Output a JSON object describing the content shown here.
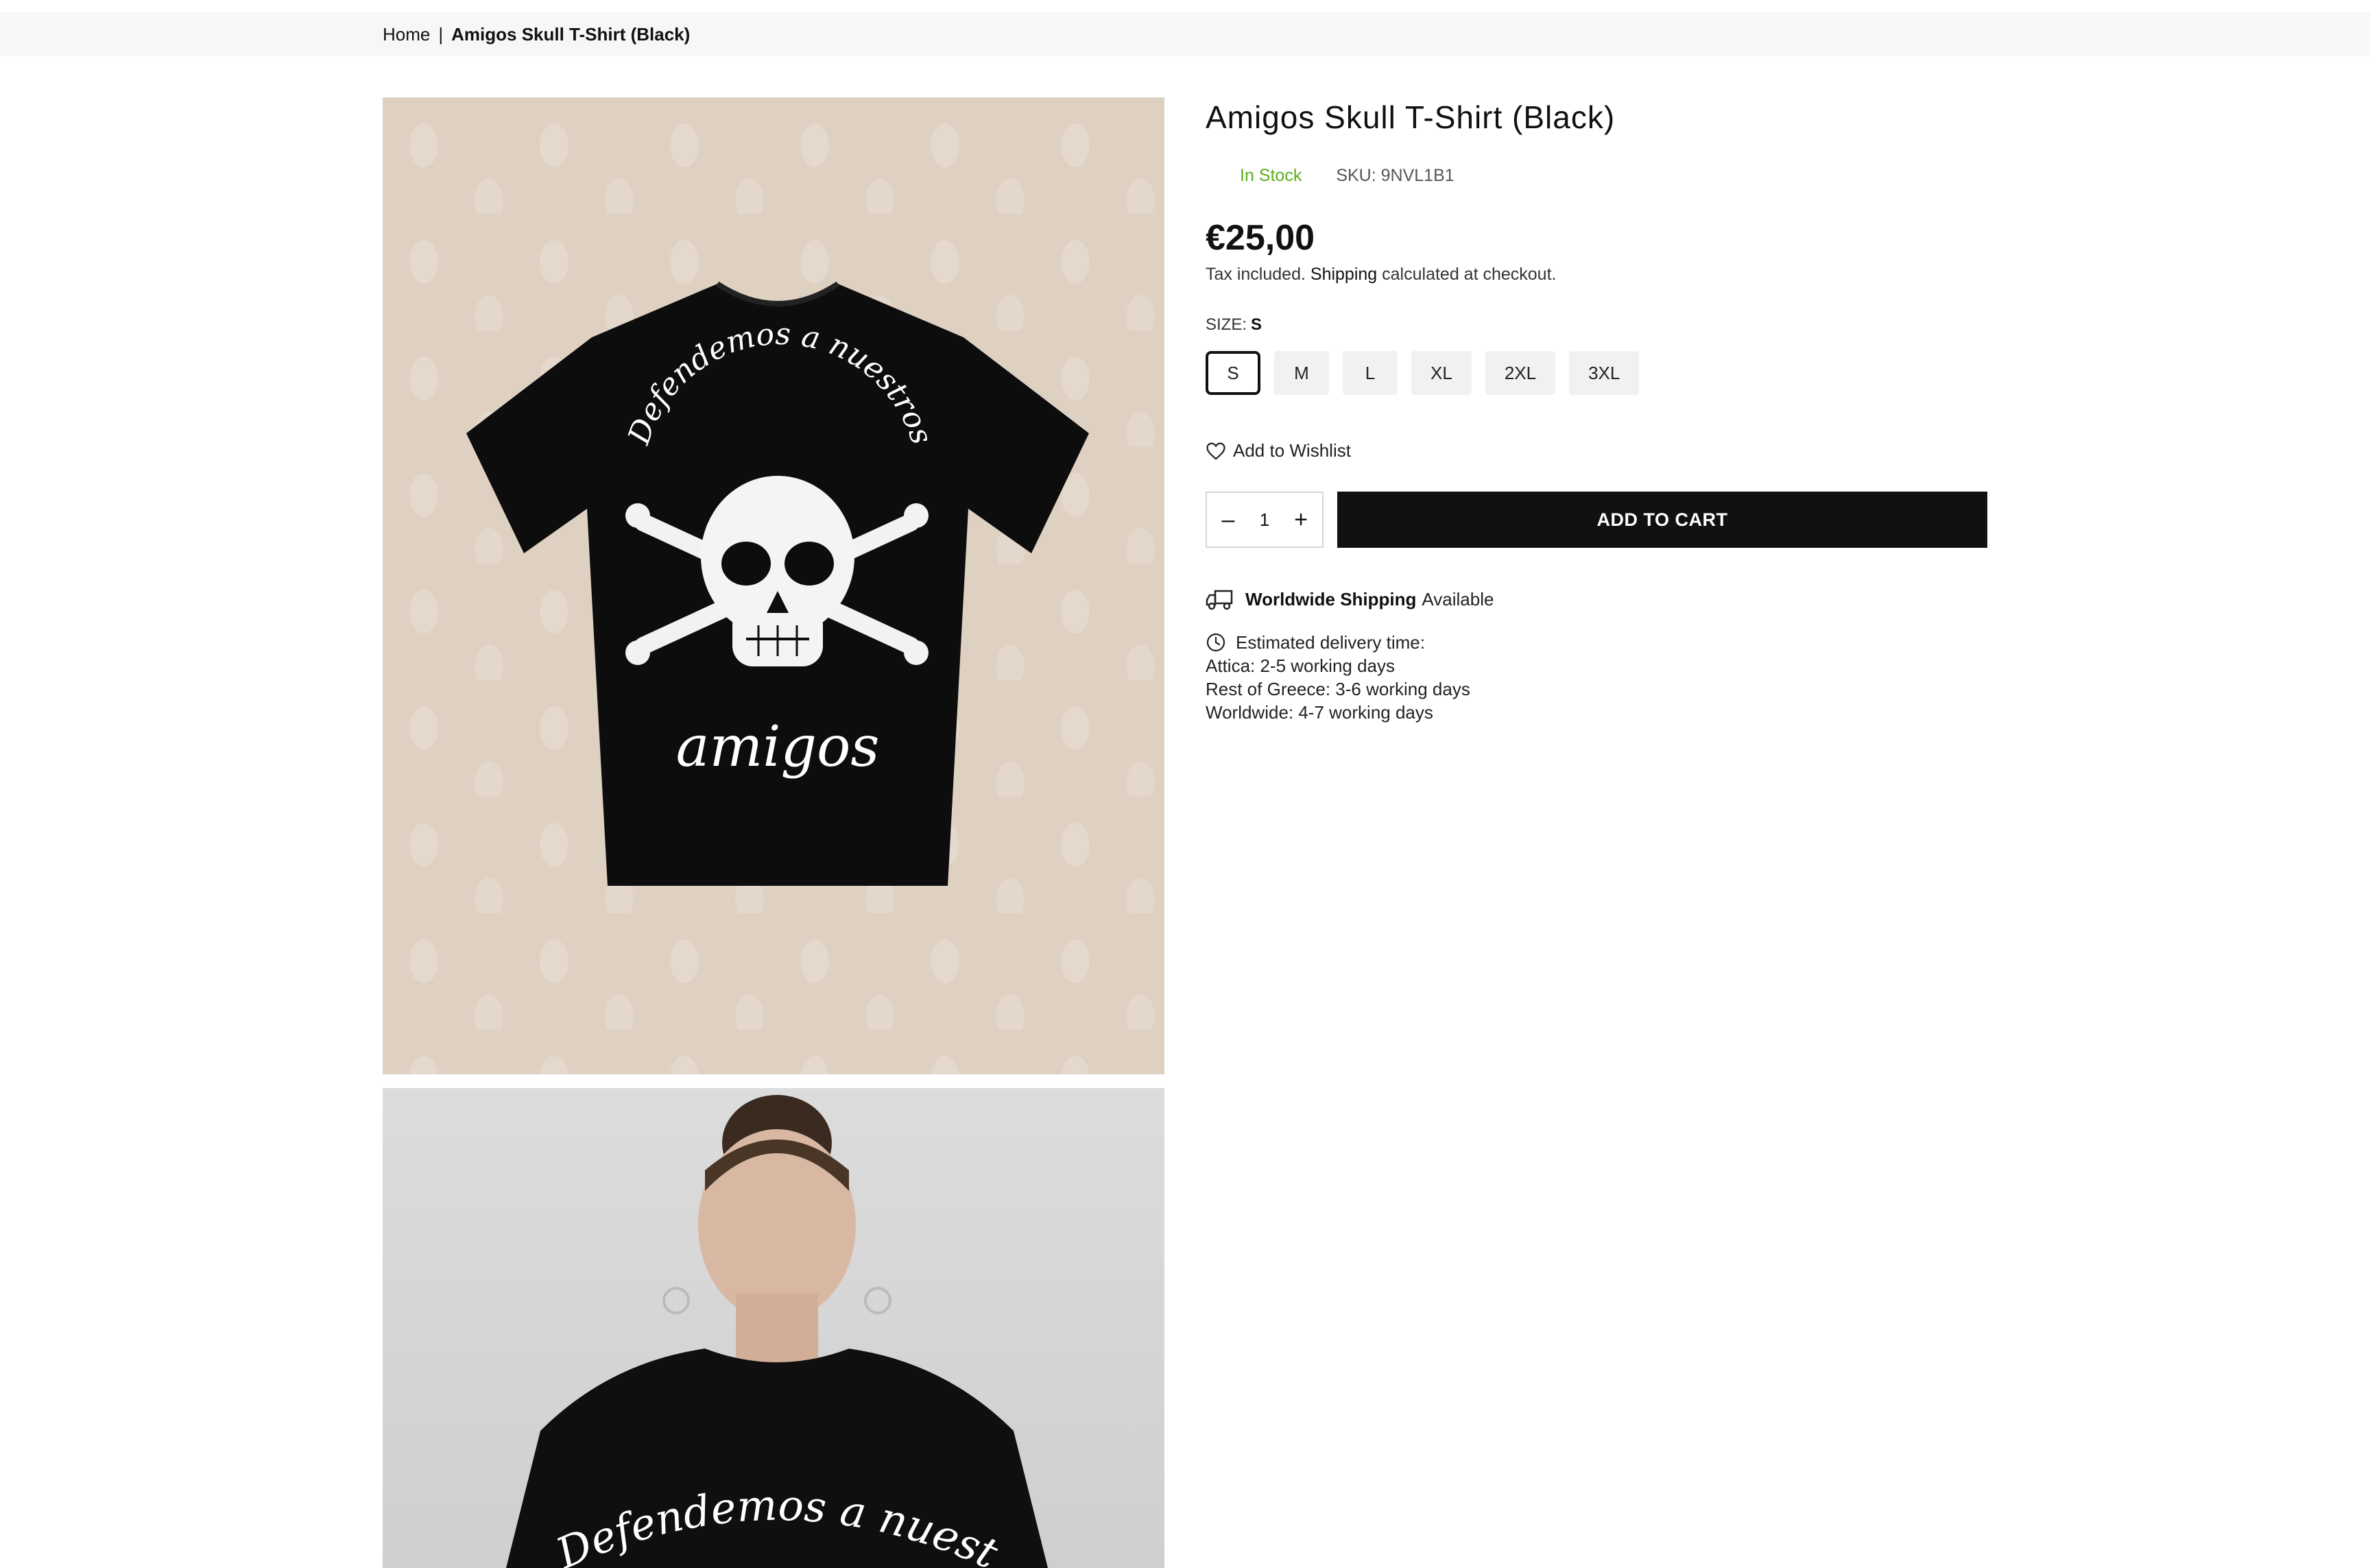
{
  "breadcrumb": {
    "home": "Home",
    "separator": "|",
    "current": "Amigos Skull T-Shirt (Black)"
  },
  "product": {
    "title": "Amigos Skull T-Shirt (Black)",
    "stock": "In Stock",
    "sku": "SKU: 9NVL1B1",
    "price": "€25,00",
    "tax_prefix": "Tax included.",
    "tax_link": "Shipping",
    "tax_suffix": "calculated at checkout.",
    "size_label": "SIZE:",
    "size_selected": "S",
    "sizes": [
      "S",
      "M",
      "L",
      "XL",
      "2XL",
      "3XL"
    ],
    "wishlist": "Add to Wishlist",
    "quantity": "1",
    "qty_minus": "–",
    "qty_plus": "+",
    "add_to_cart": "ADD TO CART",
    "shipping_bold": "Worldwide Shipping",
    "shipping_rest": "Available",
    "delivery_head": "Estimated delivery time:",
    "delivery_lines": [
      "Attica: 2-5 working days",
      "Rest of Greece: 3-6 working days",
      "Worldwide: 4-7 working days"
    ]
  },
  "gallery": {
    "shirt_text_top": "Defendemos a nuestros",
    "shirt_text_bottom": "amigos",
    "photo_text": "Defendemos a nuest"
  },
  "colors": {
    "stock": "#5cae1a",
    "button": "#111111",
    "image_bg": "#dfd1c2"
  },
  "icons": [
    "heart-icon",
    "truck-icon",
    "clock-icon"
  ]
}
